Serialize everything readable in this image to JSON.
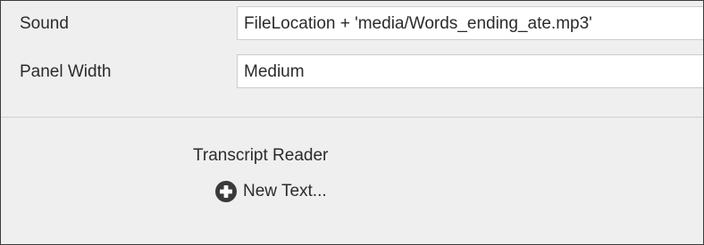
{
  "properties": {
    "sound": {
      "label": "Sound",
      "value": "FileLocation + 'media/Words_ending_ate.mp3'"
    },
    "panel_width": {
      "label": "Panel Width",
      "value": "Medium"
    }
  },
  "transcript": {
    "title": "Transcript Reader",
    "add_label": "New Text...",
    "add_icon": "plus-circle-icon"
  }
}
